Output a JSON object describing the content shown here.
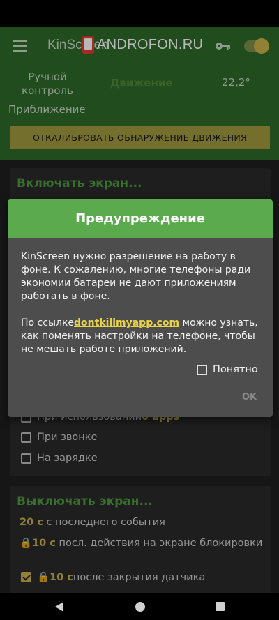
{
  "watermark": {
    "text": "ANDROFON.RU"
  },
  "appbar": {
    "title": "KinScreen",
    "menu_icon": "hamburger-icon",
    "key_icon": "key-icon"
  },
  "status": {
    "mode": "Ручной контроль",
    "movement": "Движение",
    "temperature": "22,2°",
    "proximity": "Приближение"
  },
  "calibrate_button": "ОТКАЛИБРОВАТЬ ОБНАРУЖЕНИЕ ДВИЖЕНИЯ",
  "turn_on_card": {
    "title": "Включать экран...",
    "options": [
      {
        "prefix": "При использовании ",
        "highlight": "0 apps",
        "checked": false
      },
      {
        "label": "При звонке",
        "checked": false
      },
      {
        "label": "На зарядке",
        "checked": false
      }
    ]
  },
  "turn_off_card": {
    "title": "Выключать экран...",
    "items": [
      {
        "value": "20 с",
        "text": " с последнего события"
      },
      {
        "lock": "🔒",
        "value": "10 с",
        "text": " посл. действия на экране блокировки"
      },
      {
        "lock": "🔒",
        "value": "10 с",
        "text": " после закрытия датчика",
        "checked": true
      }
    ]
  },
  "dialog": {
    "title": "Предупреждение",
    "paragraph1": "KinScreen нужно разрешение на работу в фоне. К сожалению, многие телефоны ради экономии батареи не дают приложениям работать в фоне.",
    "paragraph2_before": "По ссылке",
    "link": "dontkillmyapp.com",
    "paragraph2_after": " можно узнать, как поменять настройки на телефоне, чтобы не мешать работе приложений.",
    "checkbox_label": "Понятно",
    "checkbox_checked": false,
    "ok_label": "OK"
  },
  "colors": {
    "header": "#2f6a2a",
    "accent": "#5bab4e",
    "highlight": "#c9b24a",
    "dialog_bg": "#4d4d4d"
  }
}
